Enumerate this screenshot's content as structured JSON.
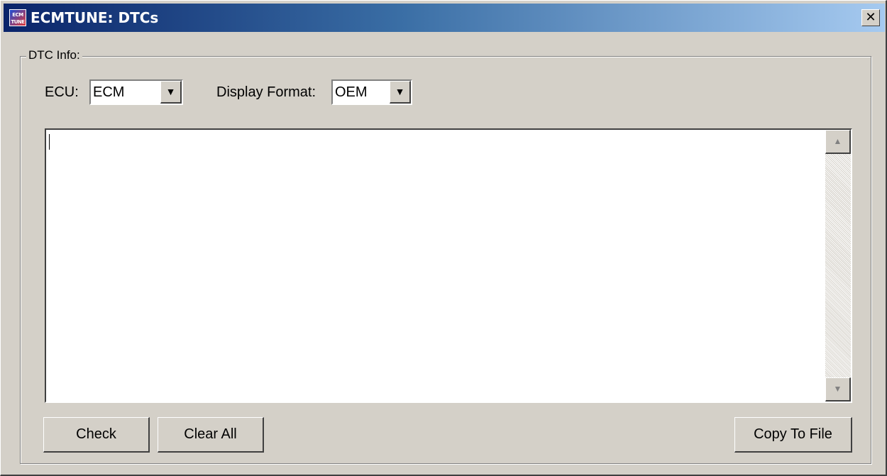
{
  "window": {
    "title": "ECMTUNE:  DTCs",
    "app_icon_text": "ECM TUNE",
    "close_glyph": "✕"
  },
  "group": {
    "legend": "DTC Info:"
  },
  "ecu": {
    "label": "ECU:",
    "selected": "ECM"
  },
  "display_format": {
    "label": "Display Format:",
    "selected": "OEM"
  },
  "output": {
    "text": ""
  },
  "buttons": {
    "check": "Check",
    "clear_all": "Clear All",
    "copy_to_file": "Copy To File"
  },
  "icons": {
    "dropdown_arrow": "▼",
    "scroll_up": "▲",
    "scroll_down": "▼"
  }
}
